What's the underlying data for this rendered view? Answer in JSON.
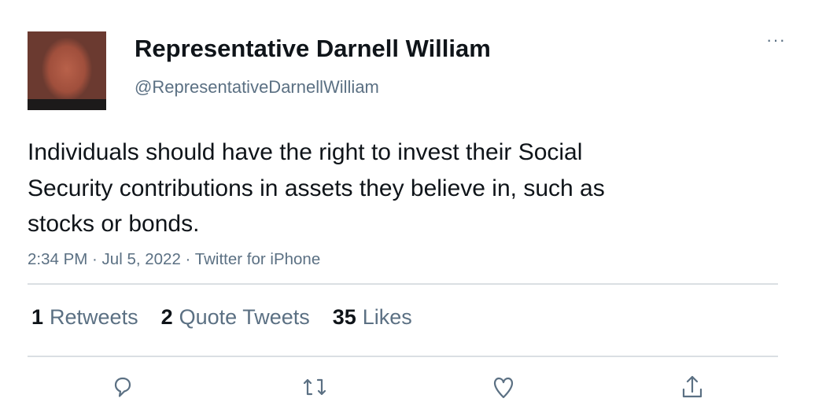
{
  "author": {
    "name": "Representative Darnell William",
    "handle": "@RepresentativeDarnellWilliam"
  },
  "more_icon": "···",
  "tweet": {
    "text": "Individuals should have the right to invest their Social Security contributions in assets they believe in, such as stocks or bonds.",
    "meta": "2:34 PM · Jul 5, 2022 · Twitter for iPhone"
  },
  "stats": {
    "retweets": {
      "count": "1",
      "label": "Retweets"
    },
    "quotes": {
      "count": "2",
      "label": "Quote Tweets"
    },
    "likes": {
      "count": "35",
      "label": "Likes"
    }
  },
  "actions": [
    "reply-icon",
    "retweet-icon",
    "like-icon",
    "share-icon"
  ]
}
